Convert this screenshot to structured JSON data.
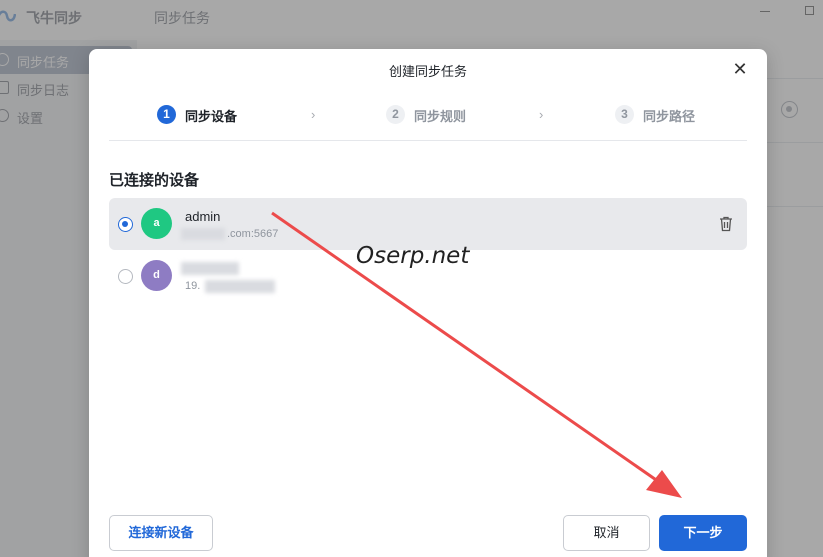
{
  "app": {
    "title": "飞牛同步",
    "page_title": "同步任务"
  },
  "sidebar": {
    "items": [
      {
        "label": "同步任务",
        "icon": "sync-icon",
        "active": true
      },
      {
        "label": "同步日志",
        "icon": "log-icon",
        "active": false
      },
      {
        "label": "设置",
        "icon": "gear-icon",
        "active": false
      }
    ]
  },
  "dialog": {
    "title": "创建同步任务",
    "close_icon": "close-icon",
    "steps": [
      {
        "number": "1",
        "label": "同步设备",
        "active": true
      },
      {
        "number": "2",
        "label": "同步规则",
        "active": false
      },
      {
        "number": "3",
        "label": "同步路径",
        "active": false
      }
    ],
    "step_separator": "›",
    "section_title": "已连接的设备",
    "devices": [
      {
        "avatar_letter": "a",
        "avatar_color": "#1fc882",
        "name": "admin",
        "address_visible": ".com:5667",
        "selected": true
      },
      {
        "avatar_letter": "d",
        "avatar_color": "#8e7cc3",
        "name": "",
        "address_visible": "19.",
        "selected": false
      }
    ],
    "buttons": {
      "connect_new": "连接新设备",
      "cancel": "取消",
      "next": "下一步"
    }
  },
  "watermark": "Oserp.net",
  "colors": {
    "primary": "#2168d8",
    "annotation_arrow": "#ec4b4b"
  }
}
